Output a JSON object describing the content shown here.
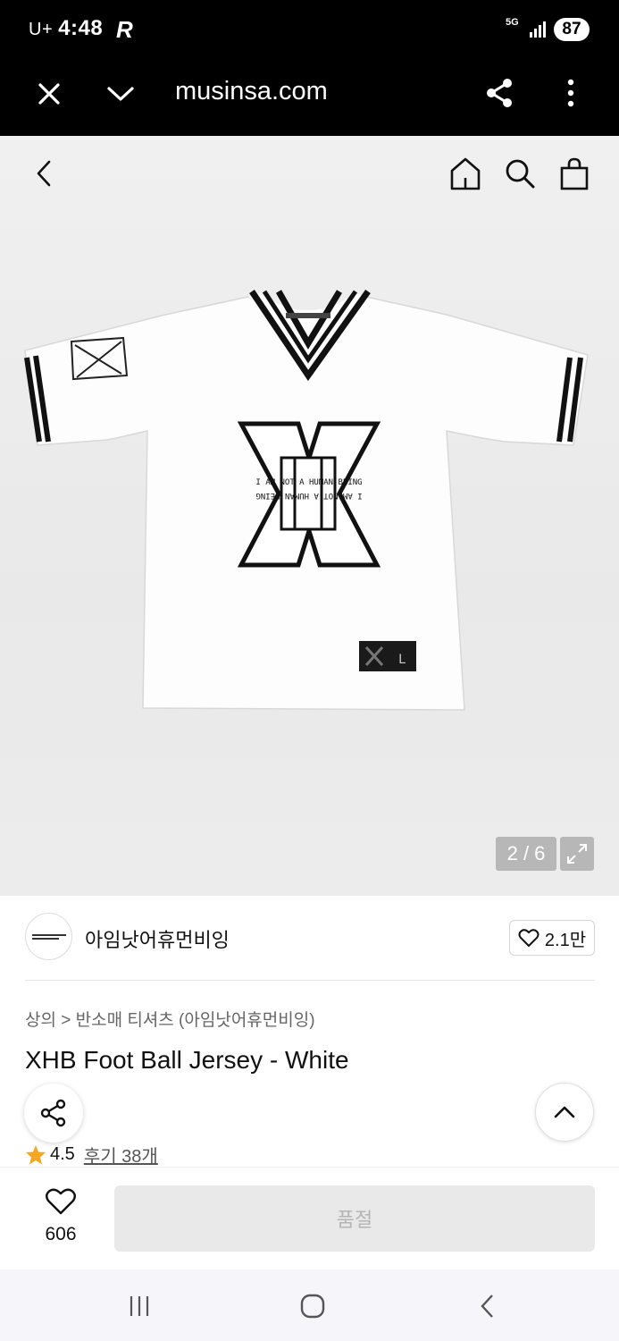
{
  "status": {
    "carrier": "U+",
    "time": "4:48",
    "app_glyph": "R",
    "network": "5G",
    "battery": "87"
  },
  "browser": {
    "url": "musinsa.com"
  },
  "gallery": {
    "counter": "2 / 6",
    "chest_text": "I AM NOT A HUMAN BEING",
    "tag_text": "L"
  },
  "brand": {
    "name": "아임낫어휴먼비잉",
    "likes": "2.1만"
  },
  "product": {
    "breadcrumb": "상의 > 반소매 티셔츠 (아임낫어휴먼비잉)",
    "title": "XHB Foot Ball Jersey - White",
    "rating": "4.5",
    "reviews": "후기 38개"
  },
  "buybar": {
    "wish_count": "606",
    "soldout_label": "품절"
  },
  "colors": {
    "star": "#f5a623",
    "statusbar": "#000000",
    "soldout_bg": "#e9e9e9"
  },
  "icons": [
    "close-icon",
    "chevron-down-icon",
    "share-icon",
    "more-icon",
    "back-icon",
    "home-icon",
    "search-icon",
    "bag-icon",
    "expand-icon",
    "heart-icon",
    "chevron-up-icon",
    "star-icon",
    "recent-apps-icon",
    "home-nav-icon",
    "back-nav-icon"
  ]
}
